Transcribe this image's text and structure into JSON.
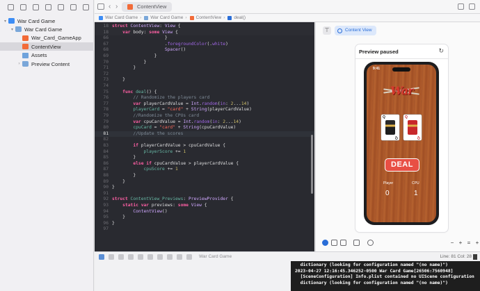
{
  "navigator": {
    "items": [
      {
        "label": "War Card Game",
        "level": 0,
        "disclosure": "▾",
        "icon": "xcode-project-icon",
        "selected": false
      },
      {
        "label": "War Card Game",
        "level": 1,
        "disclosure": "▾",
        "icon": "folder-icon",
        "selected": false
      },
      {
        "label": "War_Card_GameApp",
        "level": 2,
        "disclosure": "",
        "icon": "swift-file-icon",
        "selected": false
      },
      {
        "label": "ContentView",
        "level": 2,
        "disclosure": "",
        "icon": "swift-file-icon",
        "selected": true
      },
      {
        "label": "Assets",
        "level": 2,
        "disclosure": "",
        "icon": "asset-catalog-icon",
        "selected": false
      },
      {
        "label": "Preview Content",
        "level": 2,
        "disclosure": "›",
        "icon": "folder-icon",
        "selected": false
      }
    ]
  },
  "tabbar": {
    "back_icon": "‹",
    "forward_icon": "›",
    "active_tab": "ContentView"
  },
  "jumpbar": {
    "crumbs": [
      "War Card Game",
      "War Card Game",
      "ContentView",
      "deal()"
    ]
  },
  "editor": {
    "lines": [
      {
        "n": "18",
        "sticky": true,
        "current": false,
        "segs": [
          [
            "kw",
            "struct "
          ],
          [
            "ty",
            "ContentView"
          ],
          [
            "pl",
            ": "
          ],
          [
            "ty",
            "View"
          ],
          [
            "pl",
            " {"
          ]
        ]
      },
      {
        "n": "18",
        "sticky": true,
        "current": false,
        "segs": [
          [
            "pl",
            "    "
          ],
          [
            "kw",
            "var "
          ],
          [
            "pl",
            "body: "
          ],
          [
            "kw",
            "some "
          ],
          [
            "ty",
            "View"
          ],
          [
            "pl",
            " {"
          ]
        ]
      },
      {
        "n": "66",
        "sticky": false,
        "current": false,
        "segs": [
          [
            "pl",
            "                    }"
          ]
        ]
      },
      {
        "n": "67",
        "sticky": false,
        "current": false,
        "segs": [
          [
            "pl",
            "                    ."
          ],
          [
            "fn",
            "foregroundColor"
          ],
          [
            "pl",
            "(."
          ],
          [
            "fn",
            "white"
          ],
          [
            "pl",
            ")"
          ]
        ]
      },
      {
        "n": "68",
        "sticky": false,
        "current": false,
        "segs": [
          [
            "pl",
            "                    "
          ],
          [
            "ty",
            "Spacer"
          ],
          [
            "pl",
            "()"
          ]
        ]
      },
      {
        "n": "69",
        "sticky": false,
        "current": false,
        "segs": [
          [
            "pl",
            "                }"
          ]
        ]
      },
      {
        "n": "70",
        "sticky": false,
        "current": false,
        "segs": [
          [
            "pl",
            "            }"
          ]
        ]
      },
      {
        "n": "71",
        "sticky": false,
        "current": false,
        "segs": [
          [
            "pl",
            "        }"
          ]
        ]
      },
      {
        "n": "72",
        "sticky": false,
        "current": false,
        "segs": []
      },
      {
        "n": "73",
        "sticky": false,
        "current": false,
        "segs": [
          [
            "pl",
            "    }"
          ]
        ]
      },
      {
        "n": "74",
        "sticky": false,
        "current": false,
        "segs": []
      },
      {
        "n": "75",
        "sticky": false,
        "current": false,
        "segs": [
          [
            "pl",
            "    "
          ],
          [
            "kw",
            "func "
          ],
          [
            "nm",
            "deal"
          ],
          [
            "pl",
            "() {"
          ]
        ]
      },
      {
        "n": "76",
        "sticky": false,
        "current": false,
        "segs": [
          [
            "cm",
            "        // Randomize the players card"
          ]
        ]
      },
      {
        "n": "77",
        "sticky": false,
        "current": false,
        "segs": [
          [
            "pl",
            "        "
          ],
          [
            "kw",
            "var "
          ],
          [
            "pl",
            "playerCardValue = "
          ],
          [
            "ty",
            "Int"
          ],
          [
            "pl",
            "."
          ],
          [
            "fn",
            "random"
          ],
          [
            "pl",
            "("
          ],
          [
            "fn",
            "in"
          ],
          [
            "pl",
            ": "
          ],
          [
            "nu",
            "2"
          ],
          [
            "pl",
            "..."
          ],
          [
            "nu",
            "14"
          ],
          [
            "pl",
            ")"
          ]
        ]
      },
      {
        "n": "78",
        "sticky": false,
        "current": false,
        "segs": [
          [
            "pl",
            "        "
          ],
          [
            "nm",
            "playerCard"
          ],
          [
            "pl",
            " = "
          ],
          [
            "st",
            "\"card\""
          ],
          [
            "pl",
            " + "
          ],
          [
            "ty",
            "String"
          ],
          [
            "pl",
            "(playerCardValue)"
          ]
        ]
      },
      {
        "n": "79",
        "sticky": false,
        "current": false,
        "segs": [
          [
            "cm",
            "        //Randomize the CPUs card"
          ]
        ]
      },
      {
        "n": "79",
        "sticky": false,
        "current": false,
        "segs": [
          [
            "pl",
            "        "
          ],
          [
            "kw",
            "var "
          ],
          [
            "pl",
            "cpuCardValue = "
          ],
          [
            "ty",
            "Int"
          ],
          [
            "pl",
            "."
          ],
          [
            "fn",
            "random"
          ],
          [
            "pl",
            "("
          ],
          [
            "fn",
            "in"
          ],
          [
            "pl",
            ": "
          ],
          [
            "nu",
            "2"
          ],
          [
            "pl",
            "..."
          ],
          [
            "nu",
            "14"
          ],
          [
            "pl",
            ")"
          ]
        ]
      },
      {
        "n": "80",
        "sticky": false,
        "current": false,
        "segs": [
          [
            "pl",
            "        "
          ],
          [
            "nm",
            "cpuCard"
          ],
          [
            "pl",
            " = "
          ],
          [
            "st",
            "\"card\""
          ],
          [
            "pl",
            " + "
          ],
          [
            "ty",
            "String"
          ],
          [
            "pl",
            "(cpuCardValue)"
          ]
        ]
      },
      {
        "n": "81",
        "sticky": false,
        "current": true,
        "segs": [
          [
            "cm",
            "        //Update the scores"
          ]
        ]
      },
      {
        "n": "82",
        "sticky": false,
        "current": false,
        "segs": []
      },
      {
        "n": "83",
        "sticky": false,
        "current": false,
        "segs": [
          [
            "pl",
            "        "
          ],
          [
            "kw",
            "if "
          ],
          [
            "pl",
            "playerCardValue > cpuCardValue {"
          ]
        ]
      },
      {
        "n": "84",
        "sticky": false,
        "current": false,
        "segs": [
          [
            "pl",
            "            "
          ],
          [
            "nm",
            "playerScore"
          ],
          [
            "pl",
            " += "
          ],
          [
            "nu",
            "1"
          ]
        ]
      },
      {
        "n": "85",
        "sticky": false,
        "current": false,
        "segs": [
          [
            "pl",
            "        }"
          ]
        ]
      },
      {
        "n": "86",
        "sticky": false,
        "current": false,
        "segs": [
          [
            "pl",
            "        "
          ],
          [
            "kw",
            "else if "
          ],
          [
            "pl",
            "cpuCardValue > playerCardValue {"
          ]
        ]
      },
      {
        "n": "87",
        "sticky": false,
        "current": false,
        "segs": [
          [
            "pl",
            "            "
          ],
          [
            "nm",
            "cpuScore"
          ],
          [
            "pl",
            " += "
          ],
          [
            "nu",
            "1"
          ]
        ]
      },
      {
        "n": "88",
        "sticky": false,
        "current": false,
        "segs": [
          [
            "pl",
            "        }"
          ]
        ]
      },
      {
        "n": "89",
        "sticky": false,
        "current": false,
        "segs": [
          [
            "pl",
            "    }"
          ]
        ]
      },
      {
        "n": "90",
        "sticky": false,
        "current": false,
        "segs": [
          [
            "pl",
            "}"
          ]
        ]
      },
      {
        "n": "91",
        "sticky": false,
        "current": false,
        "segs": []
      },
      {
        "n": "92",
        "sticky": false,
        "current": false,
        "segs": [
          [
            "kw",
            "struct "
          ],
          [
            "nm",
            "ContentView_Previews"
          ],
          [
            "pl",
            ": "
          ],
          [
            "ty",
            "PreviewProvider"
          ],
          [
            "pl",
            " {"
          ]
        ]
      },
      {
        "n": "93",
        "sticky": false,
        "current": false,
        "segs": [
          [
            "pl",
            "    "
          ],
          [
            "kw",
            "static var "
          ],
          [
            "pl",
            "previews: "
          ],
          [
            "kw",
            "some "
          ],
          [
            "ty",
            "View"
          ],
          [
            "pl",
            " {"
          ]
        ]
      },
      {
        "n": "94",
        "sticky": false,
        "current": false,
        "segs": [
          [
            "pl",
            "        "
          ],
          [
            "ty",
            "ContentView"
          ],
          [
            "pl",
            "()"
          ]
        ]
      },
      {
        "n": "95",
        "sticky": false,
        "current": false,
        "segs": [
          [
            "pl",
            "    }"
          ]
        ]
      },
      {
        "n": "96",
        "sticky": false,
        "current": false,
        "segs": [
          [
            "pl",
            "}"
          ]
        ]
      },
      {
        "n": "97",
        "sticky": false,
        "current": false,
        "segs": []
      }
    ]
  },
  "canvas": {
    "chip_label": "Content View",
    "preview_title": "Preview paused",
    "refresh_icon": "↻",
    "pin_icon": "⊤",
    "app": {
      "status_time": "9:41",
      "logo": "War",
      "player_card": {
        "rank": "Q",
        "color": "#1f1f1f"
      },
      "cpu_card": {
        "rank": "Q",
        "color": "#c8282b"
      },
      "deal_label": "DEAL",
      "player_label": "Player",
      "cpu_label": "CPU",
      "player_score": "0",
      "cpu_score": "1"
    },
    "zoom_buttons": [
      "−",
      "+",
      "=",
      "+"
    ]
  },
  "debugbar": {
    "scheme": "War Card Game",
    "line_col": "Line: 81  Col: 28"
  },
  "console": {
    "lines": [
      "  dictionary (looking for configuration named \"(no name)\")",
      "2023-04-27 12:16:45.346252-0500 War Card Game[26506:7560948]",
      "  [SceneConfiguration] Info.plist contained no UIScene configuration",
      "  dictionary (looking for configuration named \"(no name)\")"
    ]
  },
  "colors": {
    "editor_bg": "#292a30",
    "keyword": "#fc5fa3",
    "comment": "#7f8c98",
    "string": "#fc6a5d",
    "number": "#d0bf69",
    "accent": "#2a6ed8",
    "deal_button": "#e84f44"
  }
}
